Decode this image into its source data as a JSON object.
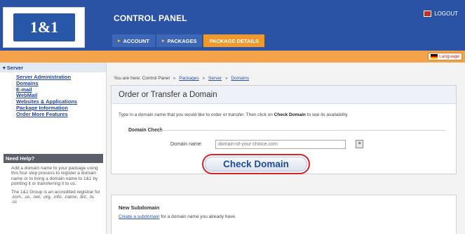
{
  "header": {
    "logo": "1&1",
    "title": "CONTROL PANEL",
    "logout": "LOGOUT",
    "tabs": [
      {
        "label": "ACCOUNT",
        "active": false
      },
      {
        "label": "PACKAGES",
        "active": false
      },
      {
        "label": "PACKAGE DETAILS",
        "active": true
      }
    ],
    "language_button": "Language"
  },
  "sidebar": {
    "section": "Server",
    "items": [
      "Server Administration",
      "Domains",
      "E-mail",
      "WebMail",
      "Websites & Applications",
      "Package Information",
      "Order More Features"
    ],
    "help_title": "Need Help?",
    "help_text_1": "Add a domain name to your package using this four step process to register a domain name or to bring a domain name to 1&1 by pointing it or transferring it to us.",
    "help_text_2": "The 1&1 Group is an accredited registrar for .com, .us, .net, .org, .info, .name, .biz, .tv, .cc"
  },
  "breadcrumb": {
    "prefix": "You are here: Control Panel",
    "items": [
      "Packages",
      "Server",
      "Domains"
    ]
  },
  "main": {
    "title": "Order or Transfer a Domain",
    "description_before": "Type in a domain name that you would like to order or transfer. Then click on",
    "description_bold": "Check Domain",
    "description_after": "to see its availability.",
    "check_section": "Domain Check",
    "domain_label": "Domain name:",
    "domain_value": "domain-of-your-choice.com",
    "check_button": "Check Domain"
  },
  "subdomain": {
    "title": "New Subdomain",
    "link": "Create a subdomain",
    "text": "for a domain name you already have."
  },
  "colors": {
    "header_blue": "#2b53a5",
    "orange": "#f5a34b",
    "highlight_red": "#d7232a"
  }
}
